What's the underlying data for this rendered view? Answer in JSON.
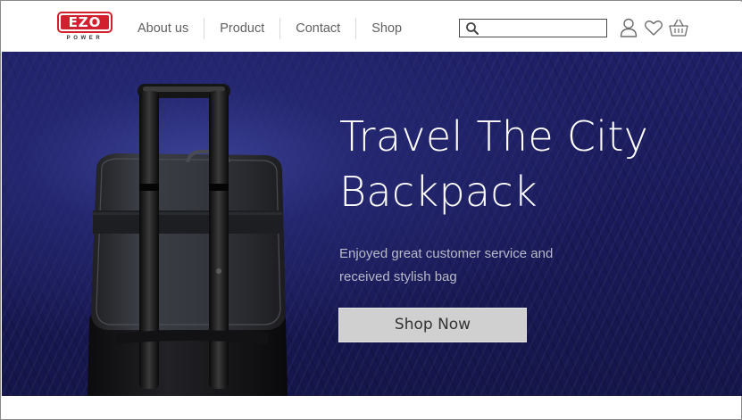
{
  "brand": {
    "logo_text": "EZO",
    "logo_subtext": "POWER",
    "accent_color": "#d3202f"
  },
  "nav": {
    "items": [
      {
        "label": "About us"
      },
      {
        "label": "Product"
      },
      {
        "label": "Contact"
      },
      {
        "label": "Shop"
      }
    ]
  },
  "search": {
    "value": "",
    "placeholder": "",
    "icon": "search-icon"
  },
  "header_icons": [
    "user-icon",
    "heart-icon",
    "basket-icon"
  ],
  "hero": {
    "title_line1": "Travel The City",
    "title_line2": "Backpack",
    "subtitle_line1": "Enjoyed great customer service and",
    "subtitle_line2": "received stylish bag",
    "cta_label": "Shop Now",
    "background_color": "#1e1f66"
  }
}
